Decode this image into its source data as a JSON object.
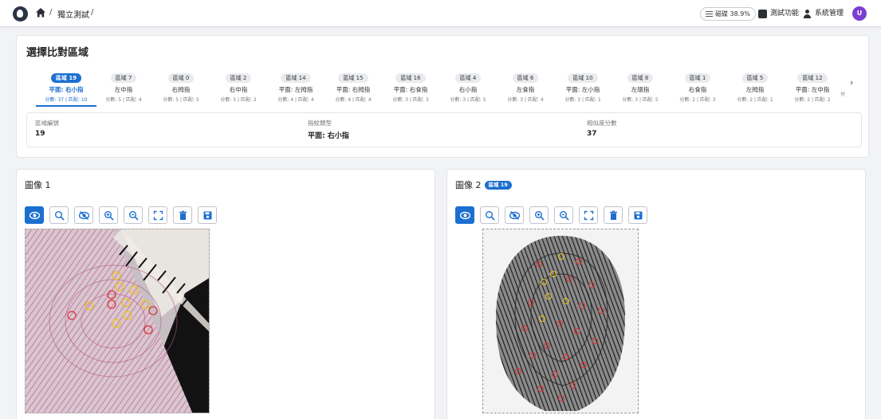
{
  "header": {
    "breadcrumb_sep": "/",
    "breadcrumb_item": "獨立測試",
    "progress_label": "磁碟 38.9%",
    "progress_fraction": 0.389,
    "test_feature_label": "測試功能",
    "system_admin_label": "系統管理",
    "avatar_initial": "U",
    "avatar_color": "#7a3fd0"
  },
  "region_panel": {
    "title": "選擇比對區域",
    "tabs": [
      {
        "chip": "區域 19",
        "type": "平面: 右小指",
        "score": "分數: 37 | 匹配: 10",
        "active": true
      },
      {
        "chip": "區域 7",
        "type": "左中指",
        "score": "分數: 5 | 匹配: 4"
      },
      {
        "chip": "區域 0",
        "type": "右拇指",
        "score": "分數: 5 | 匹配: 5"
      },
      {
        "chip": "區域 2",
        "type": "右中指",
        "score": "分數: 5 | 匹配: 2"
      },
      {
        "chip": "區域 14",
        "type": "平面: 左拇指",
        "score": "分數: 4 | 匹配: 4"
      },
      {
        "chip": "區域 15",
        "type": "平面: 右拇指",
        "score": "分數: 4 | 匹配: 4"
      },
      {
        "chip": "區域 16",
        "type": "平面: 右食指",
        "score": "分數: 3 | 匹配: 3"
      },
      {
        "chip": "區域 4",
        "type": "右小指",
        "score": "分數: 3 | 匹配: 5"
      },
      {
        "chip": "區域 6",
        "type": "左食指",
        "score": "分數: 3 | 匹配: 4"
      },
      {
        "chip": "區域 10",
        "type": "平面: 左小指",
        "score": "分數: 3 | 匹配: 1"
      },
      {
        "chip": "區域 8",
        "type": "左環指",
        "score": "分數: 3 | 匹配: 5"
      },
      {
        "chip": "區域 1",
        "type": "右食指",
        "score": "分數: 2 | 匹配: 3"
      },
      {
        "chip": "區域 5",
        "type": "左拇指",
        "score": "分數: 2 | 匹配: 1"
      },
      {
        "chip": "區域 12",
        "type": "平面: 左中指",
        "score": "分數: 2 | 匹配: 2"
      }
    ],
    "overflow_text": "分",
    "info": {
      "region_id_label": "區域編號",
      "region_id_value": "19",
      "finger_type_label": "指紋類型",
      "finger_type_value": "平面: 右小指",
      "similarity_label": "相似度分數",
      "similarity_value": "37"
    }
  },
  "image1": {
    "title": "圖像 1"
  },
  "image2": {
    "title": "圖像 2",
    "badge": "區域 19"
  },
  "toolbar_icons": [
    "eye-icon",
    "zoom-area-icon",
    "eye-off-icon",
    "zoom-in-icon",
    "zoom-out-icon",
    "fit-screen-icon",
    "delete-icon",
    "save-icon"
  ],
  "colors": {
    "accent": "#1c6fd1",
    "match_red": "#d9343a",
    "match_yellow": "#e9c21c"
  }
}
